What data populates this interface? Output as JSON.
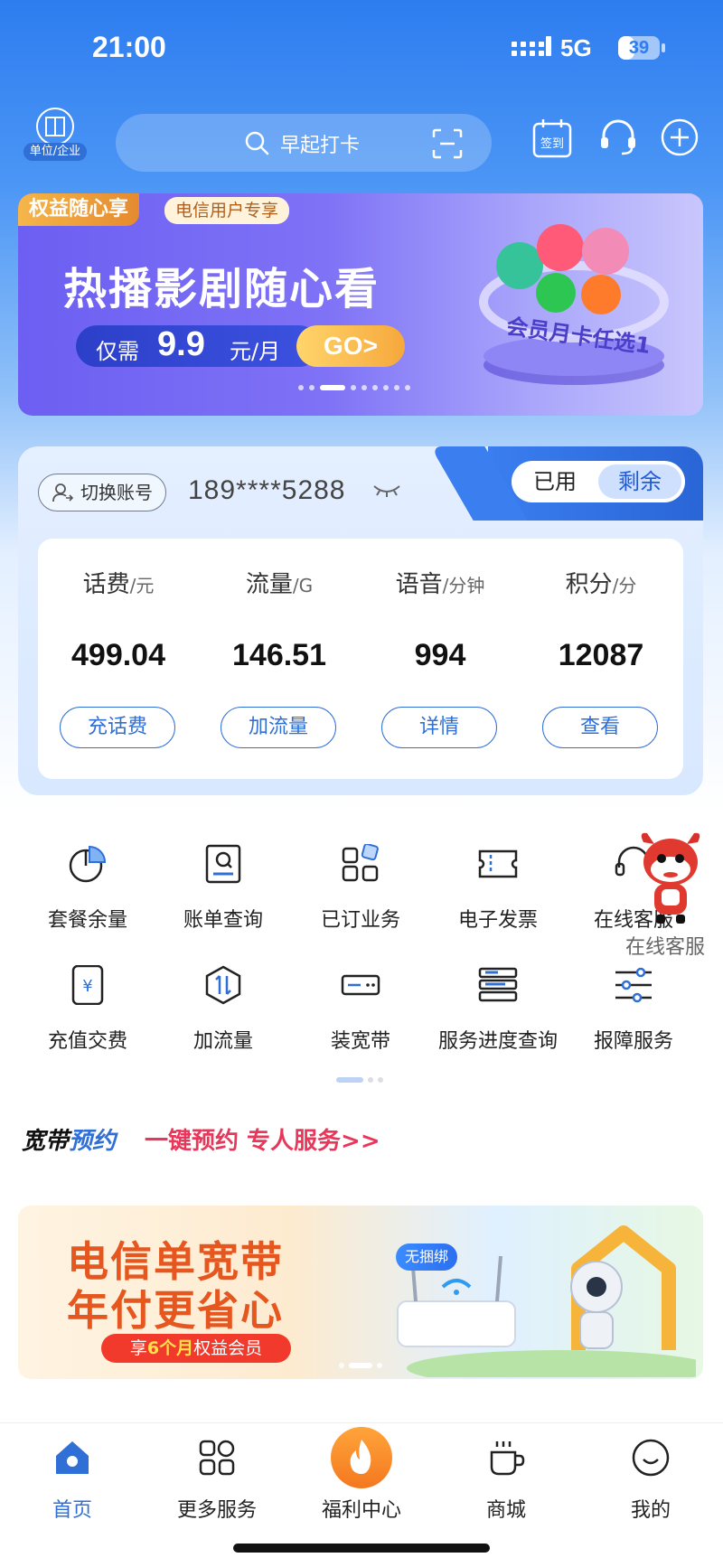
{
  "status_bar": {
    "time": "21:00",
    "network": "5G",
    "battery": "39",
    "battery_level": 0.39
  },
  "header": {
    "org_label": "单位/企业",
    "search_placeholder": "早起打卡",
    "checkin_label": "签到"
  },
  "banner_top": {
    "tag_main": "权益随心享",
    "tag_sub": "电信用户专享",
    "title": "热播影剧随心看",
    "price_prefix": "仅需",
    "price_value": "9.9",
    "price_unit": "元/月",
    "go_label": "GO>",
    "caption": "会员月卡任选1",
    "dots_total": 9,
    "dots_active_index": 2
  },
  "account": {
    "switch_label": "切换账号",
    "phone": "189****5288",
    "seg_used": "已用",
    "seg_remaining": "剩余",
    "metrics": [
      {
        "label": "话费",
        "unit": "/元",
        "value": "499.04",
        "action": "充话费"
      },
      {
        "label": "流量",
        "unit": "/G",
        "value": "146.51",
        "action": "加流量"
      },
      {
        "label": "语音",
        "unit": "/分钟",
        "value": "994",
        "action": "详情"
      },
      {
        "label": "积分",
        "unit": "/分",
        "value": "12087",
        "action": "查看"
      }
    ]
  },
  "services": [
    {
      "label": "套餐余量",
      "icon": "pie-chart-icon"
    },
    {
      "label": "账单查询",
      "icon": "bill-search-icon"
    },
    {
      "label": "已订业务",
      "icon": "apps-grid-icon"
    },
    {
      "label": "电子发票",
      "icon": "ticket-icon"
    },
    {
      "label": "在线客服",
      "icon": "headset-icon"
    },
    {
      "label": "充值交费",
      "icon": "phone-yen-icon"
    },
    {
      "label": "加流量",
      "icon": "data-transfer-icon"
    },
    {
      "label": "装宽带",
      "icon": "router-icon"
    },
    {
      "label": "服务进度查询",
      "icon": "progress-list-icon"
    },
    {
      "label": "报障服务",
      "icon": "sliders-icon"
    }
  ],
  "mascot_label": "在线客服",
  "broadband": {
    "logo_part1": "宽带",
    "logo_part2": "预约",
    "slogan": "一键预约 专人服务>>"
  },
  "banner_bottom": {
    "title_line1": "电信单宽带",
    "title_line2": "年付更省心",
    "pill_pre": "享",
    "pill_highlight": "6个月",
    "pill_post": "权益会员",
    "badge": "无捆绑"
  },
  "bottom_nav": [
    {
      "label": "首页",
      "icon": "home-icon",
      "active": true
    },
    {
      "label": "更多服务",
      "icon": "grid-icon",
      "active": false
    },
    {
      "label": "福利中心",
      "icon": "fire-icon",
      "active": false
    },
    {
      "label": "商城",
      "icon": "cup-icon",
      "active": false
    },
    {
      "label": "我的",
      "icon": "smiley-icon",
      "active": false
    }
  ],
  "colors": {
    "primary": "#2f6fd6",
    "accent_red": "#e8375a",
    "orange": "#e6561f"
  }
}
